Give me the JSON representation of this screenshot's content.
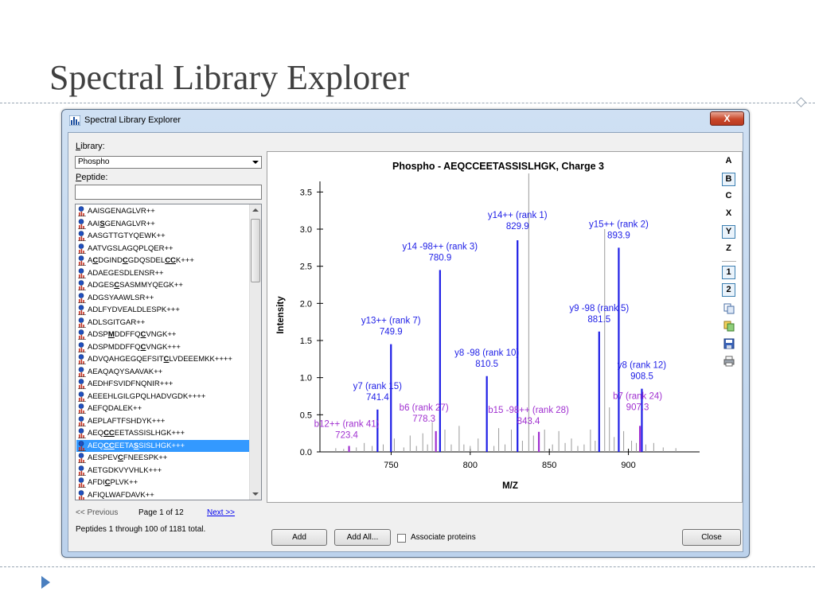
{
  "slide": {
    "title": "Spectral Library Explorer"
  },
  "window": {
    "title": "Spectral Library Explorer",
    "close_glyph": "X"
  },
  "library": {
    "label_prefix": "",
    "label_mnemonic": "L",
    "label_rest": "ibrary:",
    "selected": "Phospho"
  },
  "peptide_filter": {
    "label_mnemonic": "P",
    "label_rest": "eptide:",
    "value": ""
  },
  "peptides": [
    {
      "parts": [
        {
          "t": "AAISGENAGLVR++"
        }
      ]
    },
    {
      "parts": [
        {
          "t": "AAI"
        },
        {
          "t": "S",
          "h": true
        },
        {
          "t": "GENAGLVR++"
        }
      ]
    },
    {
      "parts": [
        {
          "t": "AASGTTGTYQEWK++"
        }
      ]
    },
    {
      "parts": [
        {
          "t": "AATVGSLAGQPLQER++"
        }
      ]
    },
    {
      "parts": [
        {
          "t": "A"
        },
        {
          "t": "C",
          "h": true
        },
        {
          "t": "DGIND"
        },
        {
          "t": "C",
          "h": true
        },
        {
          "t": "GDQSDEL"
        },
        {
          "t": "CC",
          "h": true
        },
        {
          "t": "K+++"
        }
      ]
    },
    {
      "parts": [
        {
          "t": "ADAEGESDLENSR++"
        }
      ]
    },
    {
      "parts": [
        {
          "t": "ADGES"
        },
        {
          "t": "C",
          "h": true
        },
        {
          "t": "SASMMYQEGK++"
        }
      ]
    },
    {
      "parts": [
        {
          "t": "ADGSYAAWLSR++"
        }
      ]
    },
    {
      "parts": [
        {
          "t": "ADLFYDVEALDLESPK+++"
        }
      ]
    },
    {
      "parts": [
        {
          "t": "ADLSGITGAR++"
        }
      ]
    },
    {
      "parts": [
        {
          "t": "ADSP"
        },
        {
          "t": "M",
          "h": true
        },
        {
          "t": "DDFFQ"
        },
        {
          "t": "C",
          "h": true
        },
        {
          "t": "VNGK++"
        }
      ]
    },
    {
      "parts": [
        {
          "t": "ADSPMDDFFQ"
        },
        {
          "t": "C",
          "h": true
        },
        {
          "t": "VNGK+++"
        }
      ]
    },
    {
      "parts": [
        {
          "t": "ADVQAHGEGQEFSIT"
        },
        {
          "t": "C",
          "h": true
        },
        {
          "t": "LVDEEEMKK++++"
        }
      ]
    },
    {
      "parts": [
        {
          "t": "AEAQAQYSAAVAK++"
        }
      ]
    },
    {
      "parts": [
        {
          "t": "AEDHFSVIDFNQNIR+++"
        }
      ]
    },
    {
      "parts": [
        {
          "t": "AEEEHLGILGPQLHADVGDK++++"
        }
      ]
    },
    {
      "parts": [
        {
          "t": "AEFQDALEK++"
        }
      ]
    },
    {
      "parts": [
        {
          "t": "AEPLAFTFSHDYK+++"
        }
      ]
    },
    {
      "parts": [
        {
          "t": "AEQ"
        },
        {
          "t": "CC",
          "h": true
        },
        {
          "t": "EETASSISLHGK+++"
        }
      ]
    },
    {
      "parts": [
        {
          "t": "AEQ"
        },
        {
          "t": "CC",
          "h": true
        },
        {
          "t": "EETA"
        },
        {
          "t": "S",
          "h": true
        },
        {
          "t": "SISLHGK+++"
        }
      ],
      "selected": true
    },
    {
      "parts": [
        {
          "t": "AESPEV"
        },
        {
          "t": "C",
          "h": true
        },
        {
          "t": "FNEESPK++"
        }
      ]
    },
    {
      "parts": [
        {
          "t": "AETGDKVYVHLK+++"
        }
      ]
    },
    {
      "parts": [
        {
          "t": "AFDI"
        },
        {
          "t": "C",
          "h": true
        },
        {
          "t": "PLVK++"
        }
      ]
    },
    {
      "parts": [
        {
          "t": "AFIQLWAFDAVK++"
        }
      ]
    }
  ],
  "pager": {
    "previous": "<< Previous",
    "page": "Page 1 of 12",
    "next": "Next >>",
    "status": "Peptides 1 through 100 of 1181 total."
  },
  "buttons": {
    "add": "Add",
    "add_all": "Add All...",
    "associate": "Associate proteins",
    "close": "Close"
  },
  "ion_toolbar": {
    "types": [
      "A",
      "B",
      "C",
      "X",
      "Y",
      "Z"
    ],
    "types_selected": [
      "B",
      "Y"
    ],
    "charges": [
      "1",
      "2"
    ],
    "charges_selected": [
      "1",
      "2"
    ],
    "icons": [
      "copy-icon",
      "copy-data-icon",
      "save-icon",
      "print-icon"
    ]
  },
  "colors": {
    "y_ions": "#1e1ee6",
    "b_ions": "#a030d0",
    "unmatched": "#9a9a9a",
    "selection": "#3399ff"
  },
  "chart_data": {
    "type": "bar",
    "title": "Phospho - AEQCCEETASSISLHGK, Charge 3",
    "xlabel": "M/Z",
    "ylabel": "Intensity",
    "xlim": [
      705,
      945
    ],
    "ylim": [
      0,
      3.75
    ],
    "x_ticks": [
      750,
      800,
      850,
      900
    ],
    "y_ticks": [
      0.0,
      0.5,
      1.0,
      1.5,
      2.0,
      2.5,
      3.0,
      3.5
    ],
    "y_tick_labels": [
      "0.0",
      "0.5",
      "1.0",
      "1.5",
      "2.0",
      "2.5",
      "3.0",
      "3.5"
    ],
    "matched_peaks": [
      {
        "ion": "y",
        "mz": 829.9,
        "intensity": 2.85,
        "label": "y14++ (rank 1)",
        "mz_label": "829.9"
      },
      {
        "ion": "y",
        "mz": 893.9,
        "intensity": 2.75,
        "label": "y15++ (rank 2)",
        "mz_label": "893.9"
      },
      {
        "ion": "y",
        "mz": 780.9,
        "intensity": 2.45,
        "label": "y14 -98++ (rank 3)",
        "mz_label": "780.9"
      },
      {
        "ion": "y",
        "mz": 881.5,
        "intensity": 1.62,
        "label": "y9 -98 (rank 5)",
        "mz_label": "881.5"
      },
      {
        "ion": "y",
        "mz": 749.9,
        "intensity": 1.45,
        "label": "y13++ (rank 7)",
        "mz_label": "749.9"
      },
      {
        "ion": "y",
        "mz": 810.5,
        "intensity": 1.02,
        "label": "y8 -98 (rank 10)",
        "mz_label": "810.5"
      },
      {
        "ion": "y",
        "mz": 908.5,
        "intensity": 0.85,
        "label": "y8 (rank 12)",
        "mz_label": "908.5"
      },
      {
        "ion": "y",
        "mz": 741.4,
        "intensity": 0.57,
        "label": "y7 (rank 15)",
        "mz_label": "741.4"
      },
      {
        "ion": "b",
        "mz": 907.3,
        "intensity": 0.35,
        "label": "b7 (rank 24)",
        "mz_label": "907.3"
      },
      {
        "ion": "b",
        "mz": 778.3,
        "intensity": 0.28,
        "label": "b6 (rank 27)",
        "mz_label": "778.3"
      },
      {
        "ion": "b",
        "mz": 843.4,
        "intensity": 0.27,
        "label": "b15 -98++ (rank 28)",
        "mz_label": "843.4"
      },
      {
        "ion": "b",
        "mz": 723.4,
        "intensity": 0.08,
        "label": "b12++ (rank 41)",
        "mz_label": "723.4"
      }
    ],
    "unmatched_peaks": [
      {
        "mz": 837.0,
        "intensity": 3.75
      },
      {
        "mz": 885.0,
        "intensity": 3.0
      },
      {
        "mz": 715.0,
        "intensity": 0.05
      },
      {
        "mz": 720.0,
        "intensity": 0.04
      },
      {
        "mz": 728.0,
        "intensity": 0.06
      },
      {
        "mz": 733.0,
        "intensity": 0.12
      },
      {
        "mz": 738.0,
        "intensity": 0.08
      },
      {
        "mz": 745.0,
        "intensity": 0.1
      },
      {
        "mz": 752.0,
        "intensity": 0.18
      },
      {
        "mz": 758.0,
        "intensity": 0.06
      },
      {
        "mz": 762.0,
        "intensity": 0.22
      },
      {
        "mz": 766.0,
        "intensity": 0.08
      },
      {
        "mz": 770.0,
        "intensity": 0.25
      },
      {
        "mz": 773.0,
        "intensity": 0.1
      },
      {
        "mz": 776.0,
        "intensity": 0.4
      },
      {
        "mz": 784.0,
        "intensity": 0.3
      },
      {
        "mz": 788.0,
        "intensity": 0.1
      },
      {
        "mz": 793.0,
        "intensity": 0.35
      },
      {
        "mz": 796.0,
        "intensity": 0.1
      },
      {
        "mz": 800.0,
        "intensity": 0.08
      },
      {
        "mz": 805.0,
        "intensity": 0.18
      },
      {
        "mz": 815.0,
        "intensity": 0.08
      },
      {
        "mz": 818.0,
        "intensity": 0.32
      },
      {
        "mz": 822.0,
        "intensity": 0.1
      },
      {
        "mz": 826.0,
        "intensity": 0.3
      },
      {
        "mz": 833.0,
        "intensity": 0.15
      },
      {
        "mz": 840.0,
        "intensity": 0.22
      },
      {
        "mz": 847.0,
        "intensity": 0.3
      },
      {
        "mz": 852.0,
        "intensity": 0.1
      },
      {
        "mz": 856.0,
        "intensity": 0.28
      },
      {
        "mz": 860.0,
        "intensity": 0.12
      },
      {
        "mz": 864.0,
        "intensity": 0.18
      },
      {
        "mz": 868.0,
        "intensity": 0.08
      },
      {
        "mz": 872.0,
        "intensity": 0.1
      },
      {
        "mz": 876.0,
        "intensity": 0.3
      },
      {
        "mz": 879.0,
        "intensity": 0.15
      },
      {
        "mz": 888.0,
        "intensity": 0.6
      },
      {
        "mz": 891.0,
        "intensity": 0.2
      },
      {
        "mz": 897.0,
        "intensity": 0.28
      },
      {
        "mz": 902.0,
        "intensity": 0.15
      },
      {
        "mz": 905.0,
        "intensity": 0.12
      },
      {
        "mz": 911.0,
        "intensity": 0.1
      },
      {
        "mz": 916.0,
        "intensity": 0.12
      },
      {
        "mz": 922.0,
        "intensity": 0.06
      },
      {
        "mz": 930.0,
        "intensity": 0.05
      }
    ]
  }
}
